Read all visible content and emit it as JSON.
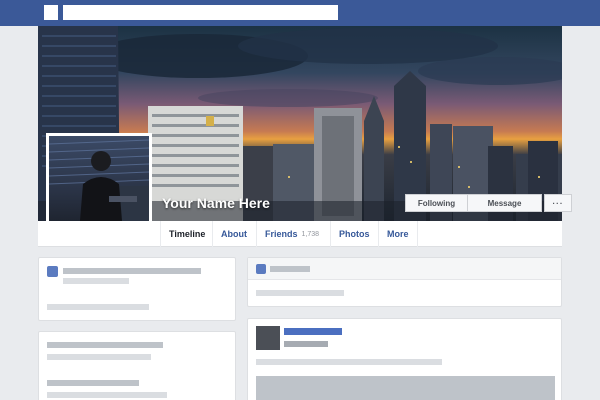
{
  "profile": {
    "name": "Your Name Here"
  },
  "cover_actions": {
    "following_label": "Following",
    "message_label": "Message",
    "more_label": "···"
  },
  "nav": {
    "tabs": [
      {
        "label": "Timeline"
      },
      {
        "label": "About"
      },
      {
        "label": "Friends",
        "count": "1,738"
      },
      {
        "label": "Photos"
      },
      {
        "label": "More"
      }
    ]
  },
  "colors": {
    "brand_bar": "#3b5998",
    "link": "#365899",
    "page_bg": "#e9ebee"
  }
}
